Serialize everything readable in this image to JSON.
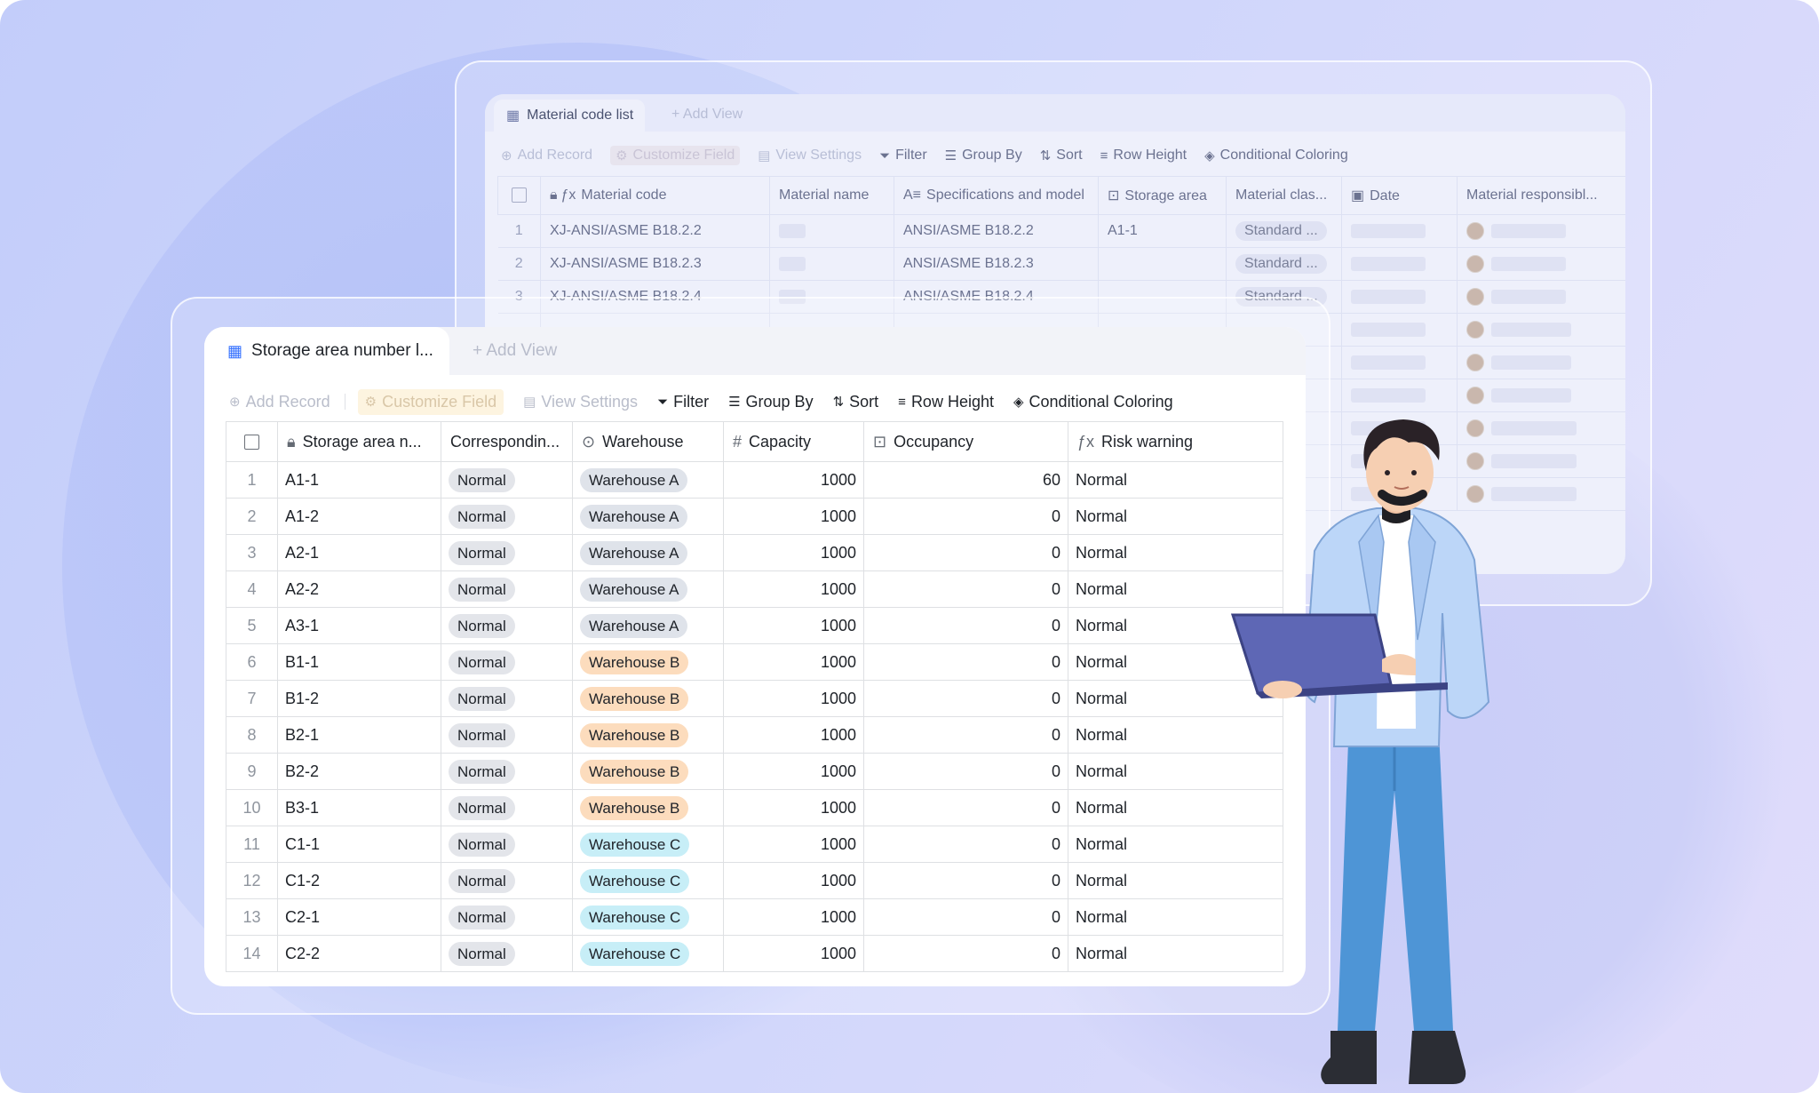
{
  "back_panel": {
    "tab_label": "Material code list",
    "add_view_label": "Add View",
    "toolbar": {
      "add_record": "Add Record",
      "customize_field": "Customize Field",
      "view_settings": "View Settings",
      "filter": "Filter",
      "group_by": "Group By",
      "sort": "Sort",
      "row_height": "Row Height",
      "conditional_coloring": "Conditional Coloring"
    },
    "columns": [
      "Material code",
      "Material name",
      "Specifications and model",
      "Storage area",
      "Material clas...",
      "Date",
      "Material responsibl..."
    ],
    "rows": [
      {
        "n": "1",
        "code": "XJ-ANSI/ASME B18.2.2",
        "spec": "ANSI/ASME B18.2.2",
        "area": "A1-1",
        "cls": "Standard ..."
      },
      {
        "n": "2",
        "code": "XJ-ANSI/ASME B18.2.3",
        "spec": "ANSI/ASME B18.2.3",
        "area": "",
        "cls": "Standard ..."
      },
      {
        "n": "3",
        "code": "XJ-ANSI/ASME B18.2.4",
        "spec": "ANSI/ASME B18.2.4",
        "area": "",
        "cls": "Standard ..."
      }
    ]
  },
  "front_panel": {
    "tab_label": "Storage area number l...",
    "add_view_label": "Add View",
    "toolbar": {
      "add_record": "Add Record",
      "customize_field": "Customize Field",
      "view_settings": "View Settings",
      "filter": "Filter",
      "group_by": "Group By",
      "sort": "Sort",
      "row_height": "Row Height",
      "conditional_coloring": "Conditional Coloring"
    },
    "columns": [
      "Storage area n...",
      "Correspondin...",
      "Warehouse",
      "Capacity",
      "Occupancy",
      "Risk warning"
    ],
    "rows": [
      {
        "n": "1",
        "area": "A1-1",
        "corr": "Normal",
        "wh": "Warehouse A",
        "cap": "1000",
        "occ": "60",
        "risk": "Normal"
      },
      {
        "n": "2",
        "area": "A1-2",
        "corr": "Normal",
        "wh": "Warehouse A",
        "cap": "1000",
        "occ": "0",
        "risk": "Normal"
      },
      {
        "n": "3",
        "area": "A2-1",
        "corr": "Normal",
        "wh": "Warehouse A",
        "cap": "1000",
        "occ": "0",
        "risk": "Normal"
      },
      {
        "n": "4",
        "area": "A2-2",
        "corr": "Normal",
        "wh": "Warehouse A",
        "cap": "1000",
        "occ": "0",
        "risk": "Normal"
      },
      {
        "n": "5",
        "area": "A3-1",
        "corr": "Normal",
        "wh": "Warehouse A",
        "cap": "1000",
        "occ": "0",
        "risk": "Normal"
      },
      {
        "n": "6",
        "area": "B1-1",
        "corr": "Normal",
        "wh": "Warehouse B",
        "cap": "1000",
        "occ": "0",
        "risk": "Normal"
      },
      {
        "n": "7",
        "area": "B1-2",
        "corr": "Normal",
        "wh": "Warehouse B",
        "cap": "1000",
        "occ": "0",
        "risk": "Normal"
      },
      {
        "n": "8",
        "area": "B2-1",
        "corr": "Normal",
        "wh": "Warehouse B",
        "cap": "1000",
        "occ": "0",
        "risk": "Normal"
      },
      {
        "n": "9",
        "area": "B2-2",
        "corr": "Normal",
        "wh": "Warehouse B",
        "cap": "1000",
        "occ": "0",
        "risk": "Normal"
      },
      {
        "n": "10",
        "area": "B3-1",
        "corr": "Normal",
        "wh": "Warehouse B",
        "cap": "1000",
        "occ": "0",
        "risk": "Normal"
      },
      {
        "n": "11",
        "area": "C1-1",
        "corr": "Normal",
        "wh": "Warehouse C",
        "cap": "1000",
        "occ": "0",
        "risk": "Normal"
      },
      {
        "n": "12",
        "area": "C1-2",
        "corr": "Normal",
        "wh": "Warehouse C",
        "cap": "1000",
        "occ": "0",
        "risk": "Normal"
      },
      {
        "n": "13",
        "area": "C2-1",
        "corr": "Normal",
        "wh": "Warehouse C",
        "cap": "1000",
        "occ": "0",
        "risk": "Normal"
      },
      {
        "n": "14",
        "area": "C2-2",
        "corr": "Normal",
        "wh": "Warehouse C",
        "cap": "1000",
        "occ": "0",
        "risk": "Normal"
      }
    ]
  },
  "colors": {
    "warehouse_a": "#dfe3ea",
    "warehouse_b": "#fcdcbd",
    "warehouse_c": "#c7eef7",
    "accent": "#3370ff"
  },
  "icons": [
    "table-icon",
    "plus-icon",
    "gear-icon",
    "filter-icon",
    "group-icon",
    "sort-icon",
    "row-height-icon",
    "paint-icon",
    "lock-icon",
    "formula-icon",
    "hash-icon",
    "option-icon"
  ]
}
